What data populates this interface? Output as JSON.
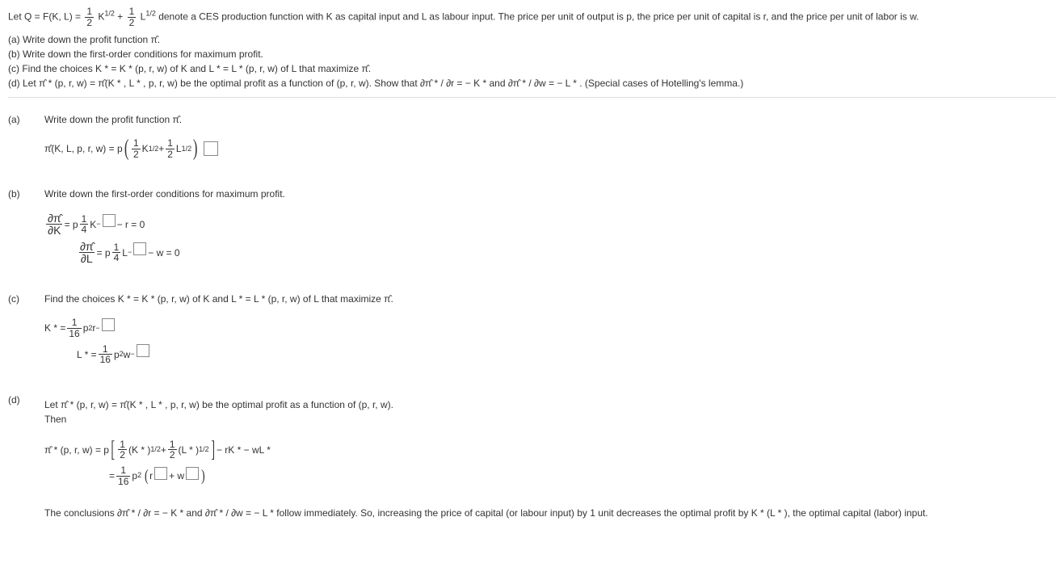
{
  "header": {
    "lead": "Let Q  =  F(K, L)  =  ",
    "frac1_num": "1",
    "frac1_den": "2",
    "t1": "K",
    "e1": "1/2",
    "plus": "  +  ",
    "frac2_num": "1",
    "frac2_den": "2",
    "t2": "L",
    "e2": "1/2",
    "tail": " denote a CES production function with K as capital input and L as labour input. The price per unit of output is p, the price per unit of capital is r, and the price per unit of labor is w."
  },
  "subq": {
    "a": "(a) Write down the profit function π̂.",
    "b": "(b) Write down the first-order conditions for maximum profit.",
    "c": "(c) Find the choices K *  = K * (p, r, w) of K and L *  = L * (p, r, w) of L that maximize π̂.",
    "d_lead": "(d) Let π̂ * (p, r, w) = π̂(K * , L * , p, r, w) be the optimal profit as a function of (p, r, w). Show that ∂π̂ *  / ∂r  =   − K *  and ∂π̂ *  / ∂w  =   − L * . (Special cases of Hotelling's lemma.)"
  },
  "labels": {
    "a": "(a)",
    "b": "(b)",
    "c": "(c)",
    "d": "(d)"
  },
  "a": {
    "prompt": "Write down the profit function π̂.",
    "lhs": "π̂(K, L, p, r, w)  =  p",
    "f1n": "1",
    "f1d": "2",
    "t1": "K",
    "e1": "1/2",
    "plus": "  +  ",
    "f2n": "1",
    "f2d": "2",
    "t2": "L",
    "e2": "1/2"
  },
  "b": {
    "prompt": "Write down the first-order conditions for maximum profit.",
    "dK_num": "∂π̂",
    "dK_den": "∂K",
    "eq": "  =  p",
    "fKn": "1",
    "fKd": "4",
    "tK": "K",
    "mK": "−",
    "tailK": "  −  r  =  0",
    "dL_num": "∂π̂",
    "dL_den": "∂L",
    "fLn": "1",
    "fLd": "4",
    "tL": "L",
    "mL": "−",
    "tailL": "  −  w  =  0"
  },
  "c": {
    "prompt": "Find the choices K *  = K * (p, r, w) of K and L *  = L * (p, r, w) of L that maximize π̂.",
    "Klhs": "K *   =  ",
    "Kn": "1",
    "Kd": "16",
    "Kbody": "p",
    "Kexp1": "2",
    "Kr": "r",
    "Kminus": "−",
    "Llhs": "L *   =  ",
    "Ln": "1",
    "Ld": "16",
    "Lbody": "p",
    "Lexp1": "2",
    "Lw": "w",
    "Lminus": "−"
  },
  "d": {
    "intro1": "Let π̂ * (p, r, w) = π̂(K * , L * , p, r, w) be the optimal profit as a function of (p, r, w).",
    "intro2": "Then",
    "lhs": "π̂ * (p, r, w)  =  p",
    "f1n": "1",
    "f1d": "2",
    "t1": "(K * )",
    "e1": "1/2",
    "plus": "  +  ",
    "f2n": "1",
    "f2d": "2",
    "t2": "(L * )",
    "e2": "1/2",
    "tail1": "  −  rK *   −  wL *",
    "eq2": "=  ",
    "sn": "1",
    "sd": "16",
    "sp": "p",
    "se": "2",
    "mid": "r",
    "mplus": "  +  w",
    "concl": "The conclusions ∂π̂ *  / ∂r  =   − K *  and ∂π̂ *  / ∂w  =   − L *  follow immediately. So, increasing the price of capital (or labour input) by 1 unit decreases the optimal profit by K * (L * ), the optimal capital (labor) input."
  }
}
